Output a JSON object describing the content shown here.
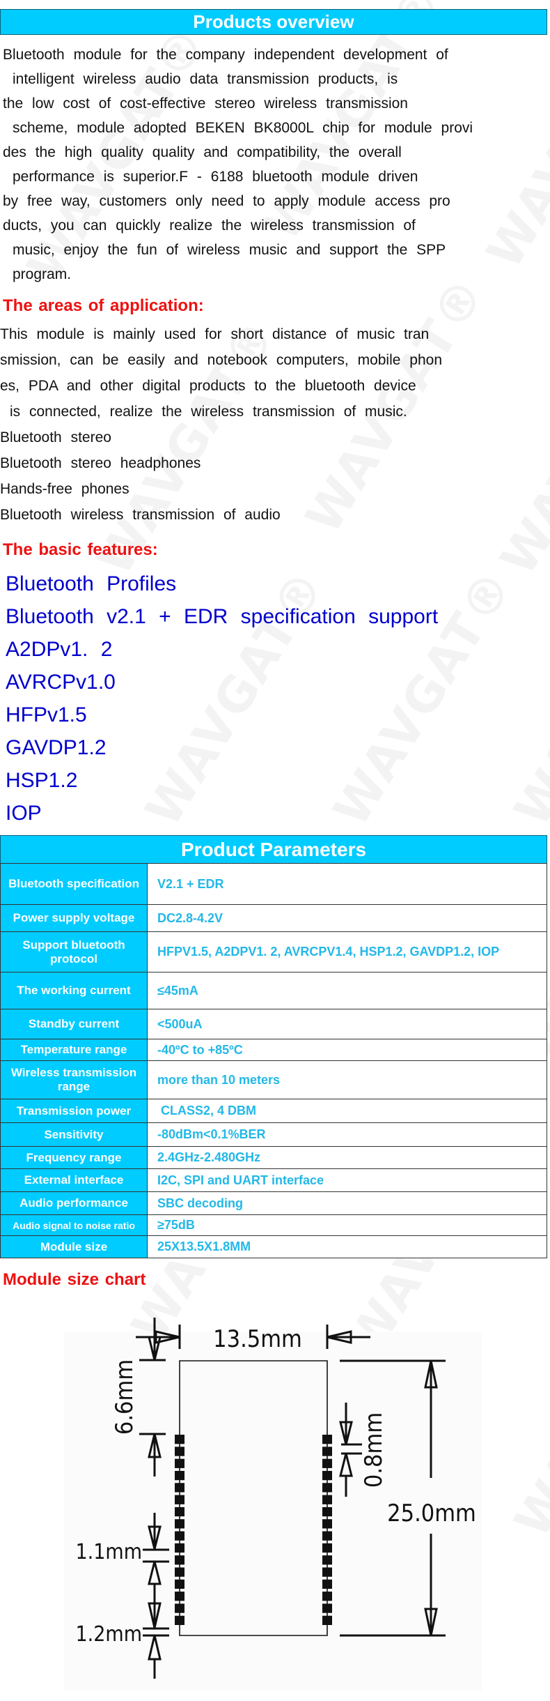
{
  "watermark": "WAVGAT®",
  "overview": {
    "title": "Products overview",
    "lines": [
      "Bluetooth module for the company independent development of",
      "intelligent wireless audio data transmission products, is",
      "the low cost of cost-effective stereo wireless transmission",
      "scheme, module adopted BEKEN BK8000L chip for module provi",
      "des the high quality quality and compatibility, the overall",
      "performance is superior.F - 6188 bluetooth module driven",
      "by free way, customers only need to apply module access pro",
      "ducts, you can quickly realize the wireless transmission of",
      "music, enjoy the fun of wireless music and support the SPP",
      "program."
    ]
  },
  "application": {
    "heading": "The areas of application:",
    "lines": [
      "This module is mainly used for short distance of music tran",
      "smission, can be easily and notebook computers, mobile phon",
      "es, PDA and other digital products to the bluetooth device",
      "is connected, realize the wireless transmission of music.",
      "Bluetooth stereo",
      "Bluetooth stereo headphones",
      "Hands-free phones",
      "Bluetooth wireless transmission of audio"
    ]
  },
  "features": {
    "heading": "The basic features:",
    "items": [
      "Bluetooth Profiles",
      "Bluetooth v2.1 + EDR specification support",
      "A2DPv1. 2",
      "AVRCPv1.0",
      "HFPv1.5",
      "GAVDP1.2",
      "HSP1.2",
      "IOP"
    ]
  },
  "parameters": {
    "title": "Product Parameters",
    "rows": [
      {
        "label": "Bluetooth specification",
        "value": "V2.1 + EDR"
      },
      {
        "label": "Power supply voltage",
        "value": "DC2.8-4.2V"
      },
      {
        "label": "Support bluetooth protocol",
        "value": "HFPV1.5, A2DPV1. 2, AVRCPV1.4, HSP1.2, GAVDP1.2, IOP"
      },
      {
        "label": "The working current",
        "value": "≤45mA"
      },
      {
        "label": "Standby current",
        "value": "<500uA"
      },
      {
        "label": "Temperature range",
        "value": "-40ºC to +85ºC"
      },
      {
        "label": "Wireless transmission range",
        "value": "more than 10 meters"
      },
      {
        "label": "Transmission power",
        "value": " CLASS2, 4 DBM"
      },
      {
        "label": "Sensitivity",
        "value": "-80dBm<0.1%BER"
      },
      {
        "label": "Frequency range",
        "value": "2.4GHz-2.480GHz"
      },
      {
        "label": "External interface",
        "value": "I2C, SPI and UART interface"
      },
      {
        "label": "Audio performance",
        "value": "SBC decoding"
      },
      {
        "label": "Audio signal to noise ratio",
        "value": "≥75dB"
      },
      {
        "label": "Module size",
        "value": "25X13.5X1.8MM"
      }
    ]
  },
  "size_chart": {
    "heading": "Module size chart",
    "width_label": "13.5mm",
    "height_label": "25.0mm",
    "top_offset_label": "6.6mm",
    "pin_pitch_label": "1.1mm",
    "bottom_offset_label": "1.2mm",
    "pad_size_label": "0.8mm",
    "pads_per_side": 16
  }
}
